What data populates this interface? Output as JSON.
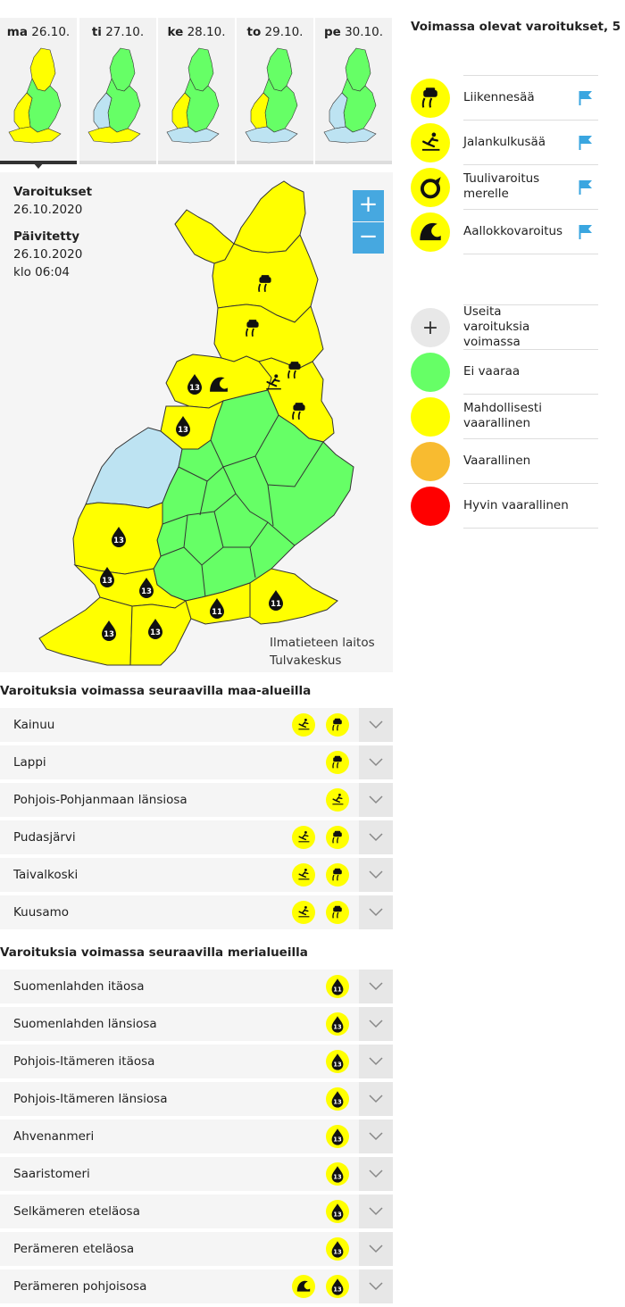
{
  "days": [
    {
      "abbr": "ma",
      "date": "26.10."
    },
    {
      "abbr": "ti",
      "date": "27.10."
    },
    {
      "abbr": "ke",
      "date": "28.10."
    },
    {
      "abbr": "to",
      "date": "29.10."
    },
    {
      "abbr": "pe",
      "date": "30.10."
    }
  ],
  "active_day": "ma",
  "map_info": {
    "warnings_label": "Varoitukset",
    "warnings_date": "26.10.2020",
    "updated_label": "Päivitetty",
    "updated_date": "26.10.2020",
    "updated_time": "klo 06:04"
  },
  "zoom": {
    "in": "+",
    "out": "−"
  },
  "attribution": {
    "line1": "Ilmatieteen laitos",
    "line2": "Tulvakeskus"
  },
  "map_labels": {
    "sea_wind_values": [
      "13",
      "13",
      "13",
      "13",
      "13",
      "13",
      "13",
      "11"
    ]
  },
  "legend": {
    "title": "Voimassa olevat varoitukset, 5",
    "warning_types": [
      {
        "label": "Liikennesää",
        "icon": "car-skid-icon"
      },
      {
        "label": "Jalankulkusää",
        "icon": "pedestrian-slip-icon"
      },
      {
        "label": "Tuulivaroitus merelle",
        "icon": "sea-wind-icon"
      },
      {
        "label": "Aallokkovaroitus",
        "icon": "wave-icon"
      }
    ],
    "levels": [
      {
        "label": "Useita varoituksia voimassa",
        "color": "#e8e8e8",
        "symbol": "+"
      },
      {
        "label": "Ei vaaraa",
        "color": "#66ff66"
      },
      {
        "label": "Mahdollisesti vaarallinen",
        "color": "#ffff00"
      },
      {
        "label": "Vaarallinen",
        "color": "#f8bb30"
      },
      {
        "label": "Hyvin vaarallinen",
        "color": "#ff0000"
      }
    ]
  },
  "land_section": {
    "title": "Varoituksia voimassa seuraavilla maa-alueilla",
    "rows": [
      {
        "name": "Kainuu",
        "icons": [
          "pedestrian-slip-icon",
          "car-skid-icon"
        ]
      },
      {
        "name": "Lappi",
        "icons": [
          "car-skid-icon"
        ]
      },
      {
        "name": "Pohjois-Pohjanmaan länsiosa",
        "icons": [
          "pedestrian-slip-icon"
        ]
      },
      {
        "name": "Pudasjärvi",
        "icons": [
          "pedestrian-slip-icon",
          "car-skid-icon"
        ]
      },
      {
        "name": "Taivalkoski",
        "icons": [
          "pedestrian-slip-icon",
          "car-skid-icon"
        ]
      },
      {
        "name": "Kuusamo",
        "icons": [
          "pedestrian-slip-icon",
          "car-skid-icon"
        ]
      }
    ]
  },
  "sea_section": {
    "title": "Varoituksia voimassa seuraavilla merialueilla",
    "rows": [
      {
        "name": "Suomenlahden itäosa",
        "wind": "11",
        "wave": false
      },
      {
        "name": "Suomenlahden länsiosa",
        "wind": "13",
        "wave": false
      },
      {
        "name": "Pohjois-Itämeren itäosa",
        "wind": "13",
        "wave": false
      },
      {
        "name": "Pohjois-Itämeren länsiosa",
        "wind": "13",
        "wave": false
      },
      {
        "name": "Ahvenanmeri",
        "wind": "13",
        "wave": false
      },
      {
        "name": "Saaristomeri",
        "wind": "13",
        "wave": false
      },
      {
        "name": "Selkämeren eteläosa",
        "wind": "13",
        "wave": false
      },
      {
        "name": "Perämeren eteläosa",
        "wind": "13",
        "wave": false
      },
      {
        "name": "Perämeren pohjoisosa",
        "wind": "13",
        "wave": true
      }
    ]
  }
}
